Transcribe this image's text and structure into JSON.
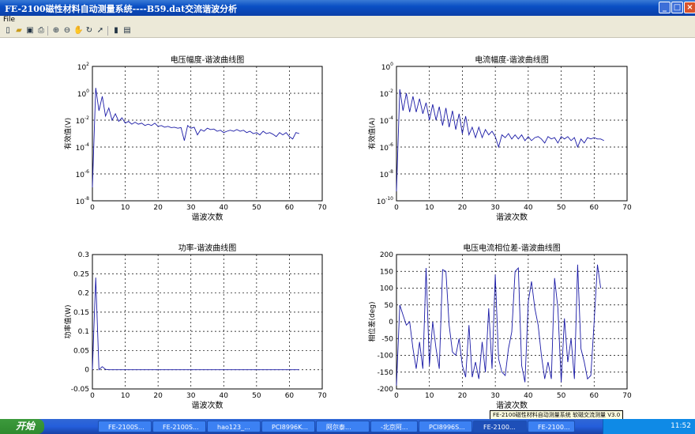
{
  "window": {
    "title": "FE-2100磁性材料自动测量系统----B59.dat交流谐波分析"
  },
  "menu": {
    "file": "File"
  },
  "toolbar_icons": [
    "new-icon",
    "open-icon",
    "save-icon",
    "print-icon",
    "zoom-in-icon",
    "zoom-out-icon",
    "pan-icon",
    "rotate-icon",
    "data-cursor-icon",
    "colorbar-icon",
    "legend-icon"
  ],
  "chart_data": [
    {
      "type": "line",
      "title": "电压幅度-谐波曲线图",
      "xlabel": "谐波次数",
      "ylabel": "有效值(V)",
      "yscale": "log",
      "xlim": [
        0,
        70
      ],
      "ylim_exp": [
        -8,
        2
      ],
      "xticks": [
        "0",
        "10",
        "20",
        "30",
        "40",
        "50",
        "60",
        "70"
      ],
      "yticks_exp": [
        "2",
        "0",
        "-2",
        "-4",
        "-6",
        "-8"
      ],
      "ytick_base": "10",
      "grid": true,
      "series": [
        {
          "color": "#1a1aa6",
          "x": [
            0,
            1,
            2,
            3,
            4,
            5,
            6,
            7,
            8,
            9,
            10,
            11,
            12,
            13,
            14,
            15,
            16,
            17,
            18,
            19,
            20,
            21,
            22,
            23,
            24,
            25,
            26,
            27,
            28,
            29,
            30,
            31,
            32,
            33,
            34,
            35,
            36,
            37,
            38,
            39,
            40,
            41,
            42,
            43,
            44,
            45,
            46,
            47,
            48,
            49,
            50,
            51,
            52,
            53,
            54,
            55,
            56,
            57,
            58,
            59,
            60,
            61,
            62,
            63
          ],
          "y": [
            1e-07,
            2.5,
            0.05,
            0.6,
            0.02,
            0.08,
            0.01,
            0.03,
            0.008,
            0.015,
            0.006,
            0.008,
            0.005,
            0.007,
            0.005,
            0.006,
            0.004,
            0.005,
            0.004,
            0.006,
            0.0035,
            0.004,
            0.003,
            0.0035,
            0.0028,
            0.003,
            0.0025,
            0.0028,
            0.0003,
            0.004,
            0.0025,
            0.003,
            0.0008,
            0.002,
            0.0015,
            0.0025,
            0.002,
            0.0022,
            0.0015,
            0.0018,
            0.0012,
            0.0015,
            0.0018,
            0.0015,
            0.002,
            0.0015,
            0.0018,
            0.0012,
            0.0015,
            0.001,
            0.0012,
            0.0008,
            0.0015,
            0.001,
            0.0012,
            0.0009,
            0.0006,
            0.0012,
            0.0008,
            0.0012,
            0.0006,
            0.0004,
            0.0012,
            0.001
          ]
        }
      ]
    },
    {
      "type": "line",
      "title": "电流幅度-谐波曲线图",
      "xlabel": "谐波次数",
      "ylabel": "有效值(A)",
      "yscale": "log",
      "xlim": [
        0,
        70
      ],
      "ylim_exp": [
        -10,
        0
      ],
      "xticks": [
        "0",
        "10",
        "20",
        "30",
        "40",
        "50",
        "60",
        "70"
      ],
      "yticks_exp": [
        "0",
        "-2",
        "-4",
        "-6",
        "-8",
        "-10"
      ],
      "ytick_base": "10",
      "grid": true,
      "series": [
        {
          "color": "#1a1aa6",
          "x": [
            0,
            1,
            2,
            3,
            4,
            5,
            6,
            7,
            8,
            9,
            10,
            11,
            12,
            13,
            14,
            15,
            16,
            17,
            18,
            19,
            20,
            21,
            22,
            23,
            24,
            25,
            26,
            27,
            28,
            29,
            30,
            31,
            32,
            33,
            34,
            35,
            36,
            37,
            38,
            39,
            40,
            41,
            42,
            43,
            44,
            45,
            46,
            47,
            48,
            49,
            50,
            51,
            52,
            53,
            54,
            55,
            56,
            57,
            58,
            59,
            60,
            61,
            62,
            63
          ],
          "y": [
            5e-10,
            0.02,
            0.0005,
            0.01,
            0.0004,
            0.006,
            0.0004,
            0.004,
            0.0003,
            0.002,
            0.0001,
            0.0015,
            0.0001,
            0.001,
            4e-05,
            0.0008,
            3e-05,
            0.0005,
            2e-05,
            0.0003,
            1e-05,
            0.0002,
            8e-06,
            3e-05,
            5e-06,
            3e-05,
            5e-06,
            2e-05,
            8e-06,
            1.5e-05,
            6e-06,
            1e-06,
            8e-06,
            5e-06,
            1e-05,
            4e-06,
            8e-06,
            4e-06,
            8e-06,
            3e-06,
            6e-06,
            3e-06,
            5e-06,
            6e-06,
            4e-06,
            2e-06,
            6e-06,
            4e-06,
            5e-06,
            2e-06,
            6e-06,
            4e-06,
            6e-06,
            3e-06,
            5e-06,
            1e-06,
            4e-06,
            2e-06,
            5e-06,
            4e-06,
            5e-06,
            4e-06,
            4e-06,
            3e-06
          ]
        }
      ]
    },
    {
      "type": "line",
      "title": "功率-谐波曲线图",
      "xlabel": "谐波次数",
      "ylabel": "功率值(W)",
      "xlim": [
        0,
        70
      ],
      "ylim": [
        -0.05,
        0.3
      ],
      "xticks": [
        "0",
        "10",
        "20",
        "30",
        "40",
        "50",
        "60",
        "70"
      ],
      "yticks": [
        "0.3",
        "0.25",
        "0.2",
        "0.15",
        "0.1",
        "0.05",
        "0",
        "-0.05"
      ],
      "grid": true,
      "series": [
        {
          "color": "#1a1aa6",
          "x": [
            0,
            1,
            2,
            3,
            4,
            5,
            6,
            63
          ],
          "y": [
            0,
            0.24,
            0.0,
            0.008,
            0.001,
            0.0,
            0.0,
            0.0
          ]
        }
      ]
    },
    {
      "type": "line",
      "title": "电压电流相位差-谐波曲线图",
      "xlabel": "谐波次数",
      "ylabel": "相位差(deg)",
      "xlim": [
        0,
        70
      ],
      "ylim": [
        -200,
        200
      ],
      "xticks": [
        "0",
        "10",
        "20",
        "30",
        "40",
        "50",
        "60",
        "70"
      ],
      "yticks": [
        "200",
        "150",
        "100",
        "50",
        "0",
        "-50",
        "-100",
        "-150",
        "-200"
      ],
      "grid": true,
      "series": [
        {
          "color": "#1a1aa6",
          "x": [
            0,
            1,
            2,
            3,
            4,
            5,
            6,
            7,
            8,
            9,
            10,
            11,
            12,
            13,
            14,
            15,
            16,
            17,
            18,
            19,
            20,
            21,
            22,
            23,
            24,
            25,
            26,
            27,
            28,
            29,
            30,
            31,
            32,
            33,
            34,
            35,
            36,
            37,
            38,
            39,
            40,
            41,
            42,
            43,
            44,
            45,
            46,
            47,
            48,
            49,
            50,
            51,
            52,
            53,
            54,
            55,
            56,
            57,
            58,
            59,
            60,
            61,
            62
          ],
          "y": [
            -190,
            50,
            20,
            -10,
            0,
            -80,
            -140,
            -60,
            -140,
            160,
            -130,
            0,
            -80,
            -140,
            155,
            150,
            -10,
            -90,
            -100,
            -50,
            -130,
            -165,
            -10,
            -165,
            -120,
            -170,
            -60,
            -150,
            40,
            -140,
            140,
            -110,
            -150,
            -160,
            -80,
            -30,
            150,
            160,
            -130,
            -180,
            60,
            120,
            40,
            -10,
            -100,
            -170,
            -120,
            -170,
            130,
            40,
            -180,
            10,
            -120,
            -50,
            -170,
            170,
            -80,
            -120,
            -170,
            -160,
            0,
            170,
            100
          ]
        }
      ]
    }
  ],
  "taskbar": {
    "start_label": "开始",
    "tasks": [
      {
        "label": "FE-2100S..."
      },
      {
        "label": "FE-2100S..."
      },
      {
        "label": "hao123_..."
      },
      {
        "label": "PCI8996K..."
      },
      {
        "label": "阿尔泰..."
      },
      {
        "label": "-北京阿..."
      },
      {
        "label": "PCI8996S..."
      },
      {
        "label": "FE-2100..."
      },
      {
        "label": "FE-2100..."
      }
    ],
    "clock": "11:52",
    "tooltip": "FE-2100磁性材料自动测量系统 软磁交流测量 V3.0"
  }
}
